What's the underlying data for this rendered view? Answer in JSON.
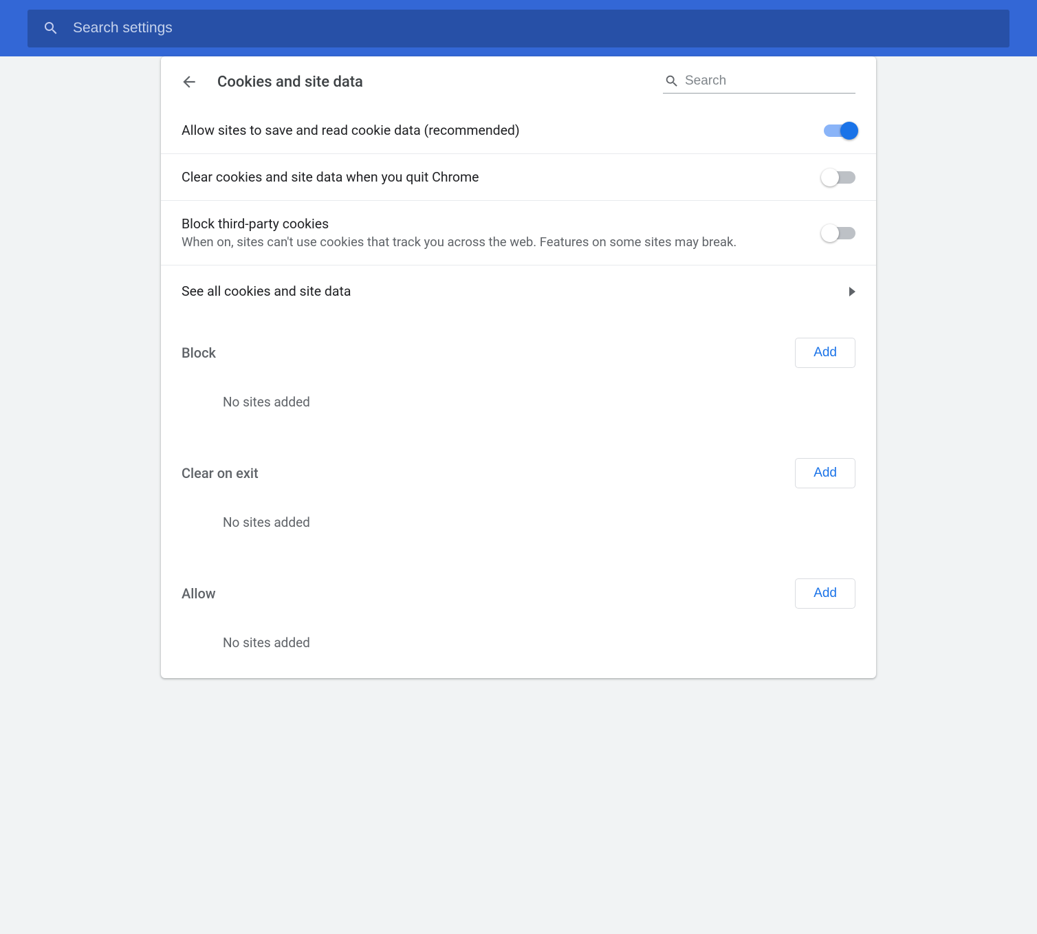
{
  "header": {
    "search_placeholder": "Search settings"
  },
  "page": {
    "title": "Cookies and site data",
    "inline_search_placeholder": "Search"
  },
  "settings": {
    "allow_cookies": {
      "label": "Allow sites to save and read cookie data (recommended)",
      "enabled": true
    },
    "clear_on_quit": {
      "label": "Clear cookies and site data when you quit Chrome",
      "enabled": false
    },
    "block_third_party": {
      "label": "Block third-party cookies",
      "desc": "When on, sites can't use cookies that track you across the web. Features on some sites may break.",
      "enabled": false
    },
    "see_all": {
      "label": "See all cookies and site data"
    }
  },
  "sections": {
    "block": {
      "title": "Block",
      "add_label": "Add",
      "empty": "No sites added"
    },
    "clear_on_exit": {
      "title": "Clear on exit",
      "add_label": "Add",
      "empty": "No sites added"
    },
    "allow": {
      "title": "Allow",
      "add_label": "Add",
      "empty": "No sites added"
    }
  }
}
